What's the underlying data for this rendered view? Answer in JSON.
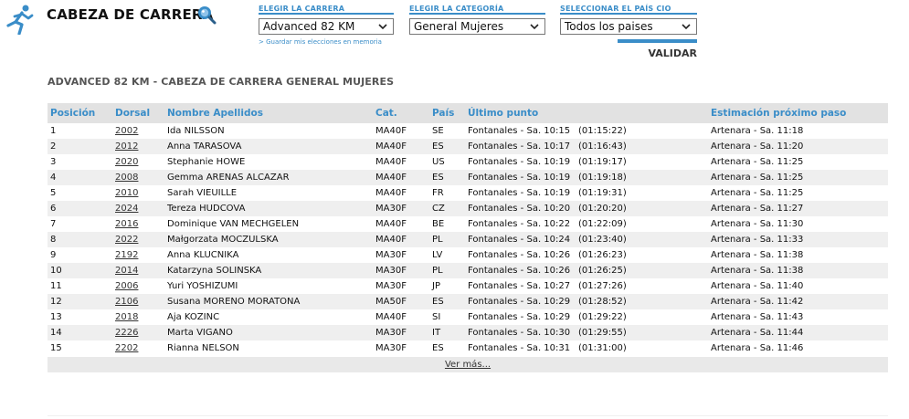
{
  "header": {
    "title": "CABEZA DE CARRERA",
    "icons": {
      "runner": "runner-icon",
      "search": "search-icon"
    }
  },
  "selectors": {
    "race": {
      "label": "ELEGIR LA CARRERA",
      "value": "Advanced 82 KM"
    },
    "category": {
      "label": "ELEGIR LA CATEGORÍA",
      "value": "General Mujeres"
    },
    "country": {
      "label": "SELECCIONAR EL PAÍS CIO",
      "value": "Todos los paises"
    },
    "memory_link": "> Guardar mis elecciones en memoria",
    "validate": "VALIDAR"
  },
  "section_title": "ADVANCED 82 KM - CABEZA DE CARRERA GENERAL MUJERES",
  "table": {
    "headers": {
      "position": "Posición",
      "bib": "Dorsal",
      "name": "Nombre Apellidos",
      "cat": "Cat.",
      "country": "País",
      "last_point": "Último punto",
      "estimate": "Estimación próximo paso"
    },
    "rows": [
      {
        "pos": "1",
        "bib": "2002",
        "name": "Ida NILSSON",
        "cat": "MA40F",
        "country": "SE",
        "point": "Fontanales - Sa. 10:15",
        "elapsed": "(01:15:22)",
        "next": "Artenara - Sa. 11:18"
      },
      {
        "pos": "2",
        "bib": "2012",
        "name": "Anna TARASOVA",
        "cat": "MA40F",
        "country": "ES",
        "point": "Fontanales - Sa. 10:17",
        "elapsed": "(01:16:43)",
        "next": "Artenara - Sa. 11:20"
      },
      {
        "pos": "3",
        "bib": "2020",
        "name": "Stephanie HOWE",
        "cat": "MA40F",
        "country": "US",
        "point": "Fontanales - Sa. 10:19",
        "elapsed": "(01:19:17)",
        "next": "Artenara - Sa. 11:25"
      },
      {
        "pos": "4",
        "bib": "2008",
        "name": "Gemma ARENAS ALCAZAR",
        "cat": "MA40F",
        "country": "ES",
        "point": "Fontanales - Sa. 10:19",
        "elapsed": "(01:19:18)",
        "next": "Artenara - Sa. 11:25"
      },
      {
        "pos": "5",
        "bib": "2010",
        "name": "Sarah VIEUILLE",
        "cat": "MA40F",
        "country": "FR",
        "point": "Fontanales - Sa. 10:19",
        "elapsed": "(01:19:31)",
        "next": "Artenara - Sa. 11:25"
      },
      {
        "pos": "6",
        "bib": "2024",
        "name": "Tereza HUDCOVA",
        "cat": "MA30F",
        "country": "CZ",
        "point": "Fontanales - Sa. 10:20",
        "elapsed": "(01:20:20)",
        "next": "Artenara - Sa. 11:27"
      },
      {
        "pos": "7",
        "bib": "2016",
        "name": "Dominique VAN MECHGELEN",
        "cat": "MA40F",
        "country": "BE",
        "point": "Fontanales - Sa. 10:22",
        "elapsed": "(01:22:09)",
        "next": "Artenara - Sa. 11:30"
      },
      {
        "pos": "8",
        "bib": "2022",
        "name": "Małgorzata MOCZULSKA",
        "cat": "MA40F",
        "country": "PL",
        "point": "Fontanales - Sa. 10:24",
        "elapsed": "(01:23:40)",
        "next": "Artenara - Sa. 11:33"
      },
      {
        "pos": "9",
        "bib": "2192",
        "name": "Anna KLUCNIKA",
        "cat": "MA30F",
        "country": "LV",
        "point": "Fontanales - Sa. 10:26",
        "elapsed": "(01:26:23)",
        "next": "Artenara - Sa. 11:38"
      },
      {
        "pos": "10",
        "bib": "2014",
        "name": "Katarzyna SOLINSKA",
        "cat": "MA30F",
        "country": "PL",
        "point": "Fontanales - Sa. 10:26",
        "elapsed": "(01:26:25)",
        "next": "Artenara - Sa. 11:38"
      },
      {
        "pos": "11",
        "bib": "2006",
        "name": "Yuri YOSHIZUMI",
        "cat": "MA30F",
        "country": "JP",
        "point": "Fontanales - Sa. 10:27",
        "elapsed": "(01:27:26)",
        "next": "Artenara - Sa. 11:40"
      },
      {
        "pos": "12",
        "bib": "2106",
        "name": "Susana MORENO MORATONA",
        "cat": "MA50F",
        "country": "ES",
        "point": "Fontanales - Sa. 10:29",
        "elapsed": "(01:28:52)",
        "next": "Artenara - Sa. 11:42"
      },
      {
        "pos": "13",
        "bib": "2018",
        "name": "Aja KOZINC",
        "cat": "MA40F",
        "country": "SI",
        "point": "Fontanales - Sa. 10:29",
        "elapsed": "(01:29:22)",
        "next": "Artenara - Sa. 11:43"
      },
      {
        "pos": "14",
        "bib": "2226",
        "name": "Marta VIGANO",
        "cat": "MA30F",
        "country": "IT",
        "point": "Fontanales - Sa. 10:30",
        "elapsed": "(01:29:55)",
        "next": "Artenara - Sa. 11:44"
      },
      {
        "pos": "15",
        "bib": "2202",
        "name": "Rianna NELSON",
        "cat": "MA30F",
        "country": "ES",
        "point": "Fontanales - Sa. 10:31",
        "elapsed": "(01:31:00)",
        "next": "Artenara - Sa. 11:46"
      }
    ],
    "more_link": "Ver más..."
  },
  "colors": {
    "accent": "#3a8dc8",
    "header_row": "#e2e2e2",
    "stripe": "#efefef"
  }
}
